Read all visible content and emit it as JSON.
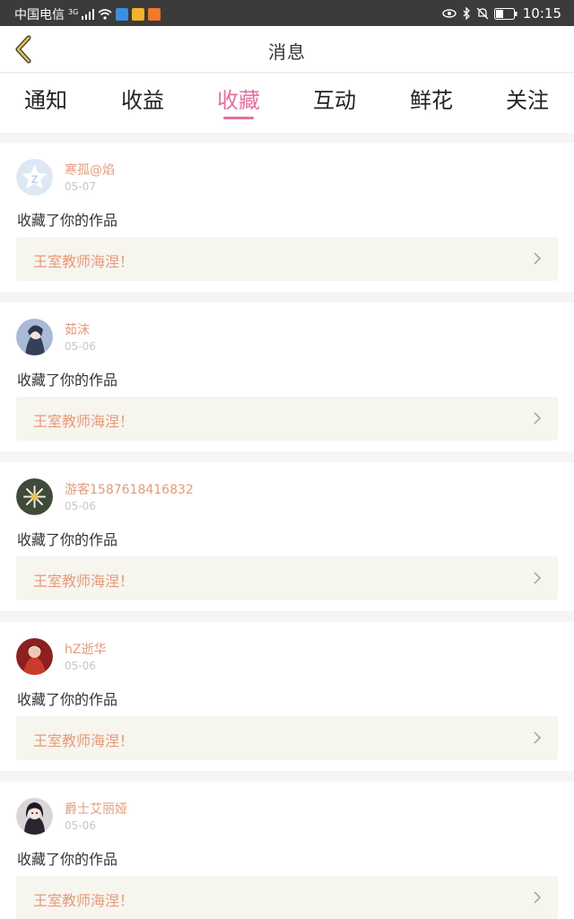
{
  "status_bar": {
    "carrier": "中国电信",
    "network": "3G",
    "time": "10:15",
    "icons": [
      "signal-icon",
      "wifi-icon",
      "shield-app-icon",
      "app-icon-yellow",
      "app-icon-orange",
      "eye-icon",
      "bluetooth-icon",
      "mute-bell-icon",
      "battery-icon"
    ]
  },
  "navbar": {
    "title": "消息",
    "back_icon": "chevron-left-icon"
  },
  "tabs": {
    "items": [
      {
        "label": "通知"
      },
      {
        "label": "收益"
      },
      {
        "label": "收藏"
      },
      {
        "label": "互动"
      },
      {
        "label": "鲜花"
      },
      {
        "label": "关注"
      }
    ],
    "active": "收藏"
  },
  "colors": {
    "accent": "#e46fa3",
    "username": "#e59a7a",
    "date": "#c6c6c6",
    "work_bg": "#f6f5ee"
  },
  "messages": [
    {
      "username": "寒孤@焰",
      "date": "05-07",
      "action": "收藏了你的作品",
      "work_title": "王室教师海涅！"
    },
    {
      "username": "茹沫",
      "date": "05-06",
      "action": "收藏了你的作品",
      "work_title": "王室教师海涅！"
    },
    {
      "username": "游客1587618416832",
      "date": "05-06",
      "action": "收藏了你的作品",
      "work_title": "王室教师海涅！"
    },
    {
      "username": "hZ逝华",
      "date": "05-06",
      "action": "收藏了你的作品",
      "work_title": "王室教师海涅！"
    },
    {
      "username": "爵士艾丽娅",
      "date": "05-06",
      "action": "收藏了你的作品",
      "work_title": "王室教师海涅！"
    }
  ]
}
